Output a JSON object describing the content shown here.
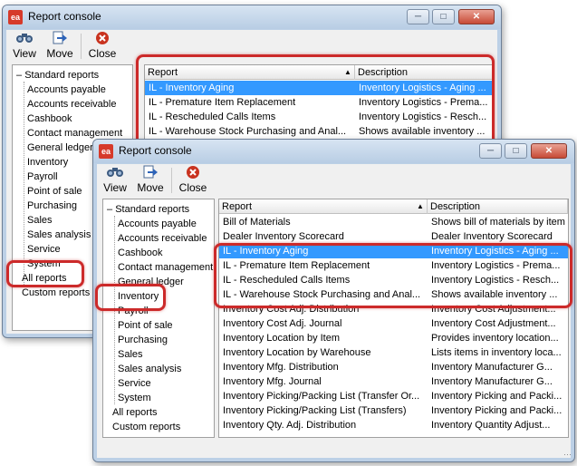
{
  "window_back": {
    "title": "Report console",
    "toolbar": {
      "view": "View",
      "move": "Move",
      "close": "Close"
    },
    "tree": {
      "root": "Standard reports",
      "children": [
        "Accounts payable",
        "Accounts receivable",
        "Cashbook",
        "Contact management",
        "General ledger",
        "Inventory",
        "Payroll",
        "Point of sale",
        "Purchasing",
        "Sales",
        "Sales analysis",
        "Service",
        "System"
      ],
      "all_reports": "All reports",
      "custom_reports": "Custom reports"
    },
    "list": {
      "col_report": "Report",
      "col_description": "Description",
      "rows": [
        {
          "report": "IL - Inventory Aging",
          "description": "Inventory Logistics - Aging ..."
        },
        {
          "report": "IL - Premature Item Replacement",
          "description": "Inventory Logistics - Prema..."
        },
        {
          "report": "IL - Rescheduled Calls Items",
          "description": "Inventory Logistics - Resch..."
        },
        {
          "report": "IL - Warehouse Stock Purchasing and Anal...",
          "description": "Shows available inventory ..."
        }
      ]
    }
  },
  "window_front": {
    "title": "Report console",
    "toolbar": {
      "view": "View",
      "move": "Move",
      "close": "Close"
    },
    "tree": {
      "root": "Standard reports",
      "children": [
        "Accounts payable",
        "Accounts receivable",
        "Cashbook",
        "Contact management",
        "General ledger",
        "Inventory",
        "Payroll",
        "Point of sale",
        "Purchasing",
        "Sales",
        "Sales analysis",
        "Service",
        "System"
      ],
      "all_reports": "All reports",
      "custom_reports": "Custom reports"
    },
    "list": {
      "col_report": "Report",
      "col_description": "Description",
      "rows": [
        {
          "report": "Bill of Materials",
          "description": "Shows bill of materials by item"
        },
        {
          "report": "Dealer Inventory Scorecard",
          "description": "Dealer Inventory Scorecard"
        },
        {
          "report": "IL - Inventory Aging",
          "description": "Inventory Logistics - Aging ..."
        },
        {
          "report": "IL - Premature Item Replacement",
          "description": "Inventory Logistics - Prema..."
        },
        {
          "report": "IL - Rescheduled Calls Items",
          "description": "Inventory Logistics - Resch..."
        },
        {
          "report": "IL - Warehouse Stock Purchasing and Anal...",
          "description": "Shows available inventory ..."
        },
        {
          "report": "Inventory Cost Adj. Distribution",
          "description": "Inventory Cost Adjustment..."
        },
        {
          "report": "Inventory Cost Adj. Journal",
          "description": "Inventory Cost Adjustment..."
        },
        {
          "report": "Inventory Location by Item",
          "description": "Provides inventory location..."
        },
        {
          "report": "Inventory Location by Warehouse",
          "description": "Lists items in inventory loca..."
        },
        {
          "report": "Inventory Mfg. Distribution",
          "description": "Inventory Manufacturer G..."
        },
        {
          "report": "Inventory Mfg. Journal",
          "description": "Inventory Manufacturer G..."
        },
        {
          "report": "Inventory Picking/Packing List (Transfer Or...",
          "description": "Inventory Picking and Packi..."
        },
        {
          "report": "Inventory Picking/Packing List (Transfers)",
          "description": "Inventory Picking and Packi..."
        },
        {
          "report": "Inventory Qty. Adj. Distribution",
          "description": "Inventory Quantity Adjust..."
        }
      ]
    }
  },
  "icons": {
    "view": "binoculars-icon",
    "move": "move-arrow-icon",
    "close": "close-icon",
    "app": "ea-app-icon"
  },
  "colors": {
    "selection": "#3399ff",
    "highlight": "#cc2a2a",
    "titlebar": "#c4d6ea"
  }
}
